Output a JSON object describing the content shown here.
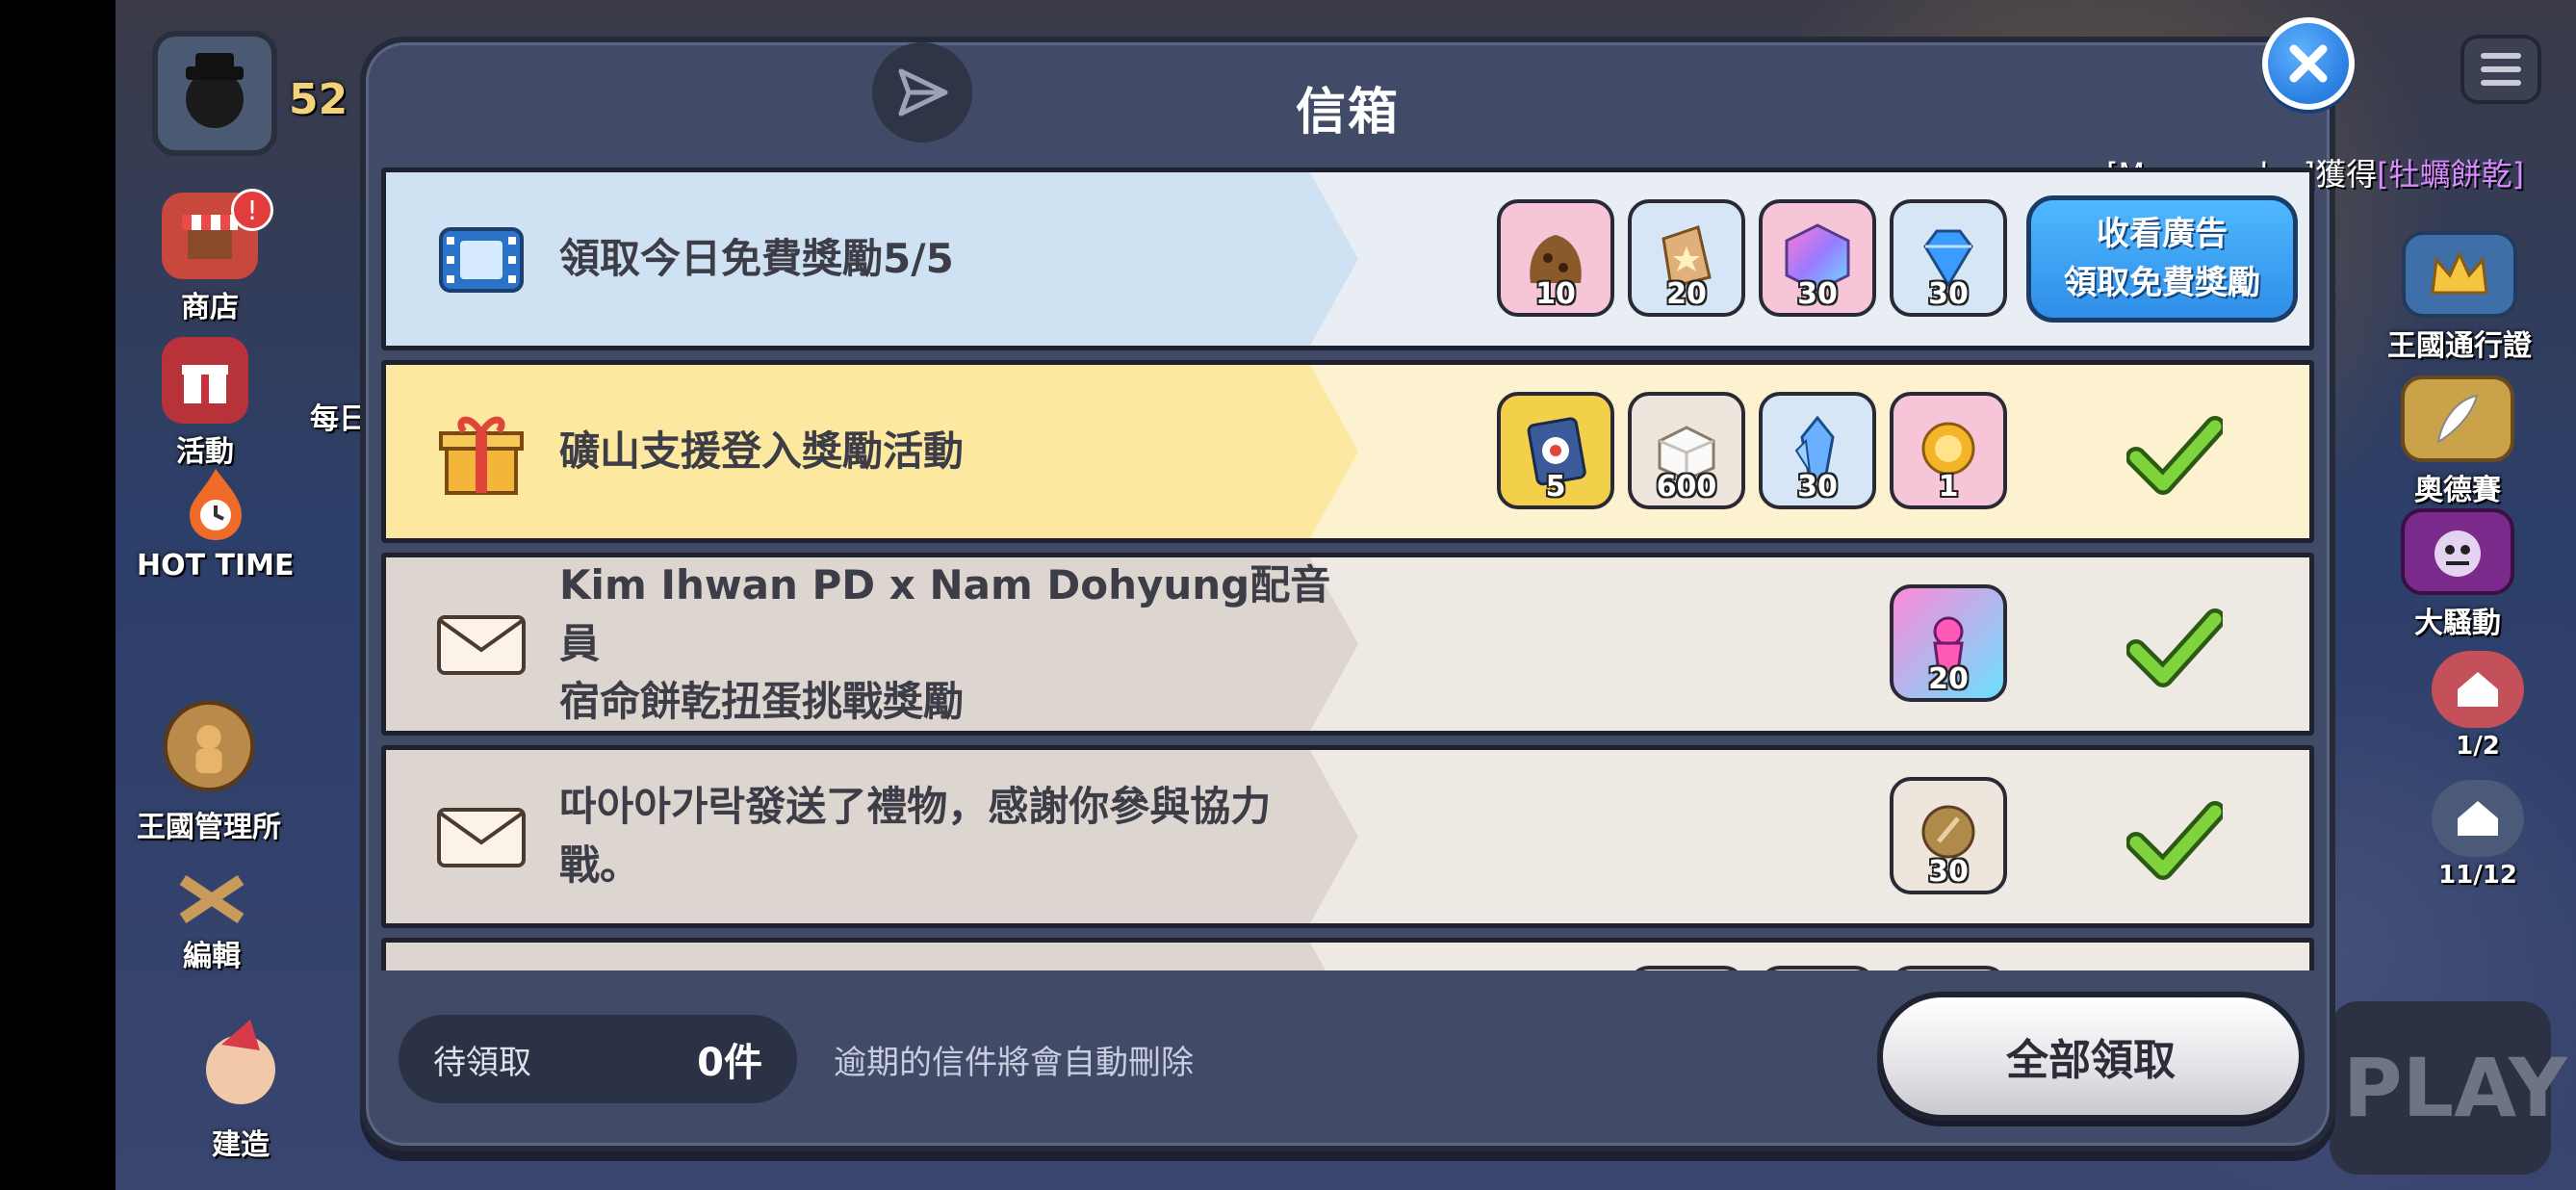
{
  "dialog": {
    "title": "信箱",
    "close_icon": "close-icon",
    "send_icon": "paper-plane-icon"
  },
  "toast": {
    "prefix": "[Meowscoles]獲得",
    "highlight": "[牡蠣餅乾]"
  },
  "hud": {
    "shop": "商店",
    "event": "活動",
    "daily": "每日",
    "hot_time": "HOT TIME",
    "kingdom_admin": "王國管理所",
    "edit": "編輯",
    "build": "建造",
    "level_partial": "52",
    "kingdom_pass": "王國通行證",
    "odyssey": "奧德賽",
    "uproar": "大騷動",
    "counter_1": "1/2",
    "counter_2": "11/12",
    "play": "PLAY",
    "shop_badge": "!"
  },
  "mails": [
    {
      "title": "領取今日免費獎勵5/5",
      "icon": "film-icon",
      "theme": "blue",
      "rewards": [
        {
          "icon": "coin-bag-icon",
          "count": "10"
        },
        {
          "icon": "star-crystal-icon",
          "count": "20"
        },
        {
          "icon": "rainbow-cube-icon",
          "count": "30"
        },
        {
          "icon": "diamond-icon",
          "count": "30"
        }
      ],
      "action": {
        "line1": "收看廣告",
        "line2": "領取免費獎勵"
      }
    },
    {
      "title": "礦山支援登入獎勵活動",
      "icon": "gift-box-icon",
      "theme": "yellow",
      "rewards": [
        {
          "icon": "treasure-card-icon",
          "count": "5"
        },
        {
          "icon": "sugar-cube-icon",
          "count": "600"
        },
        {
          "icon": "blue-crystal-icon",
          "count": "30"
        },
        {
          "icon": "gold-orb-icon",
          "count": "1"
        }
      ]
    },
    {
      "title_line1": "Kim Ihwan PD x Nam Dohyung配音員",
      "title_line2": "宿命餅乾扭蛋挑戰獎勵",
      "icon": "envelope-icon",
      "theme": "gray",
      "rewards": [
        {
          "icon": "cookie-soulstone-icon",
          "count": "20"
        }
      ]
    },
    {
      "title": "따아아가락發送了禮物，感謝你參與協力戰。",
      "icon": "envelope-icon",
      "theme": "gray",
      "rewards": [
        {
          "icon": "bronze-medal-icon",
          "count": "30"
        }
      ]
    }
  ],
  "footer": {
    "pending_label": "待領取",
    "pending_count": "0件",
    "expire_note": "逾期的信件將會自動刪除",
    "claim_all": "全部領取"
  },
  "colors": {
    "dialog_bg": "#414a66",
    "row_blue": "#cfe2f3",
    "row_yellow": "#fde8a0",
    "row_gray": "#ddd6d0",
    "check_green": "#7fd33c",
    "ad_button": "#2f8ee8"
  }
}
